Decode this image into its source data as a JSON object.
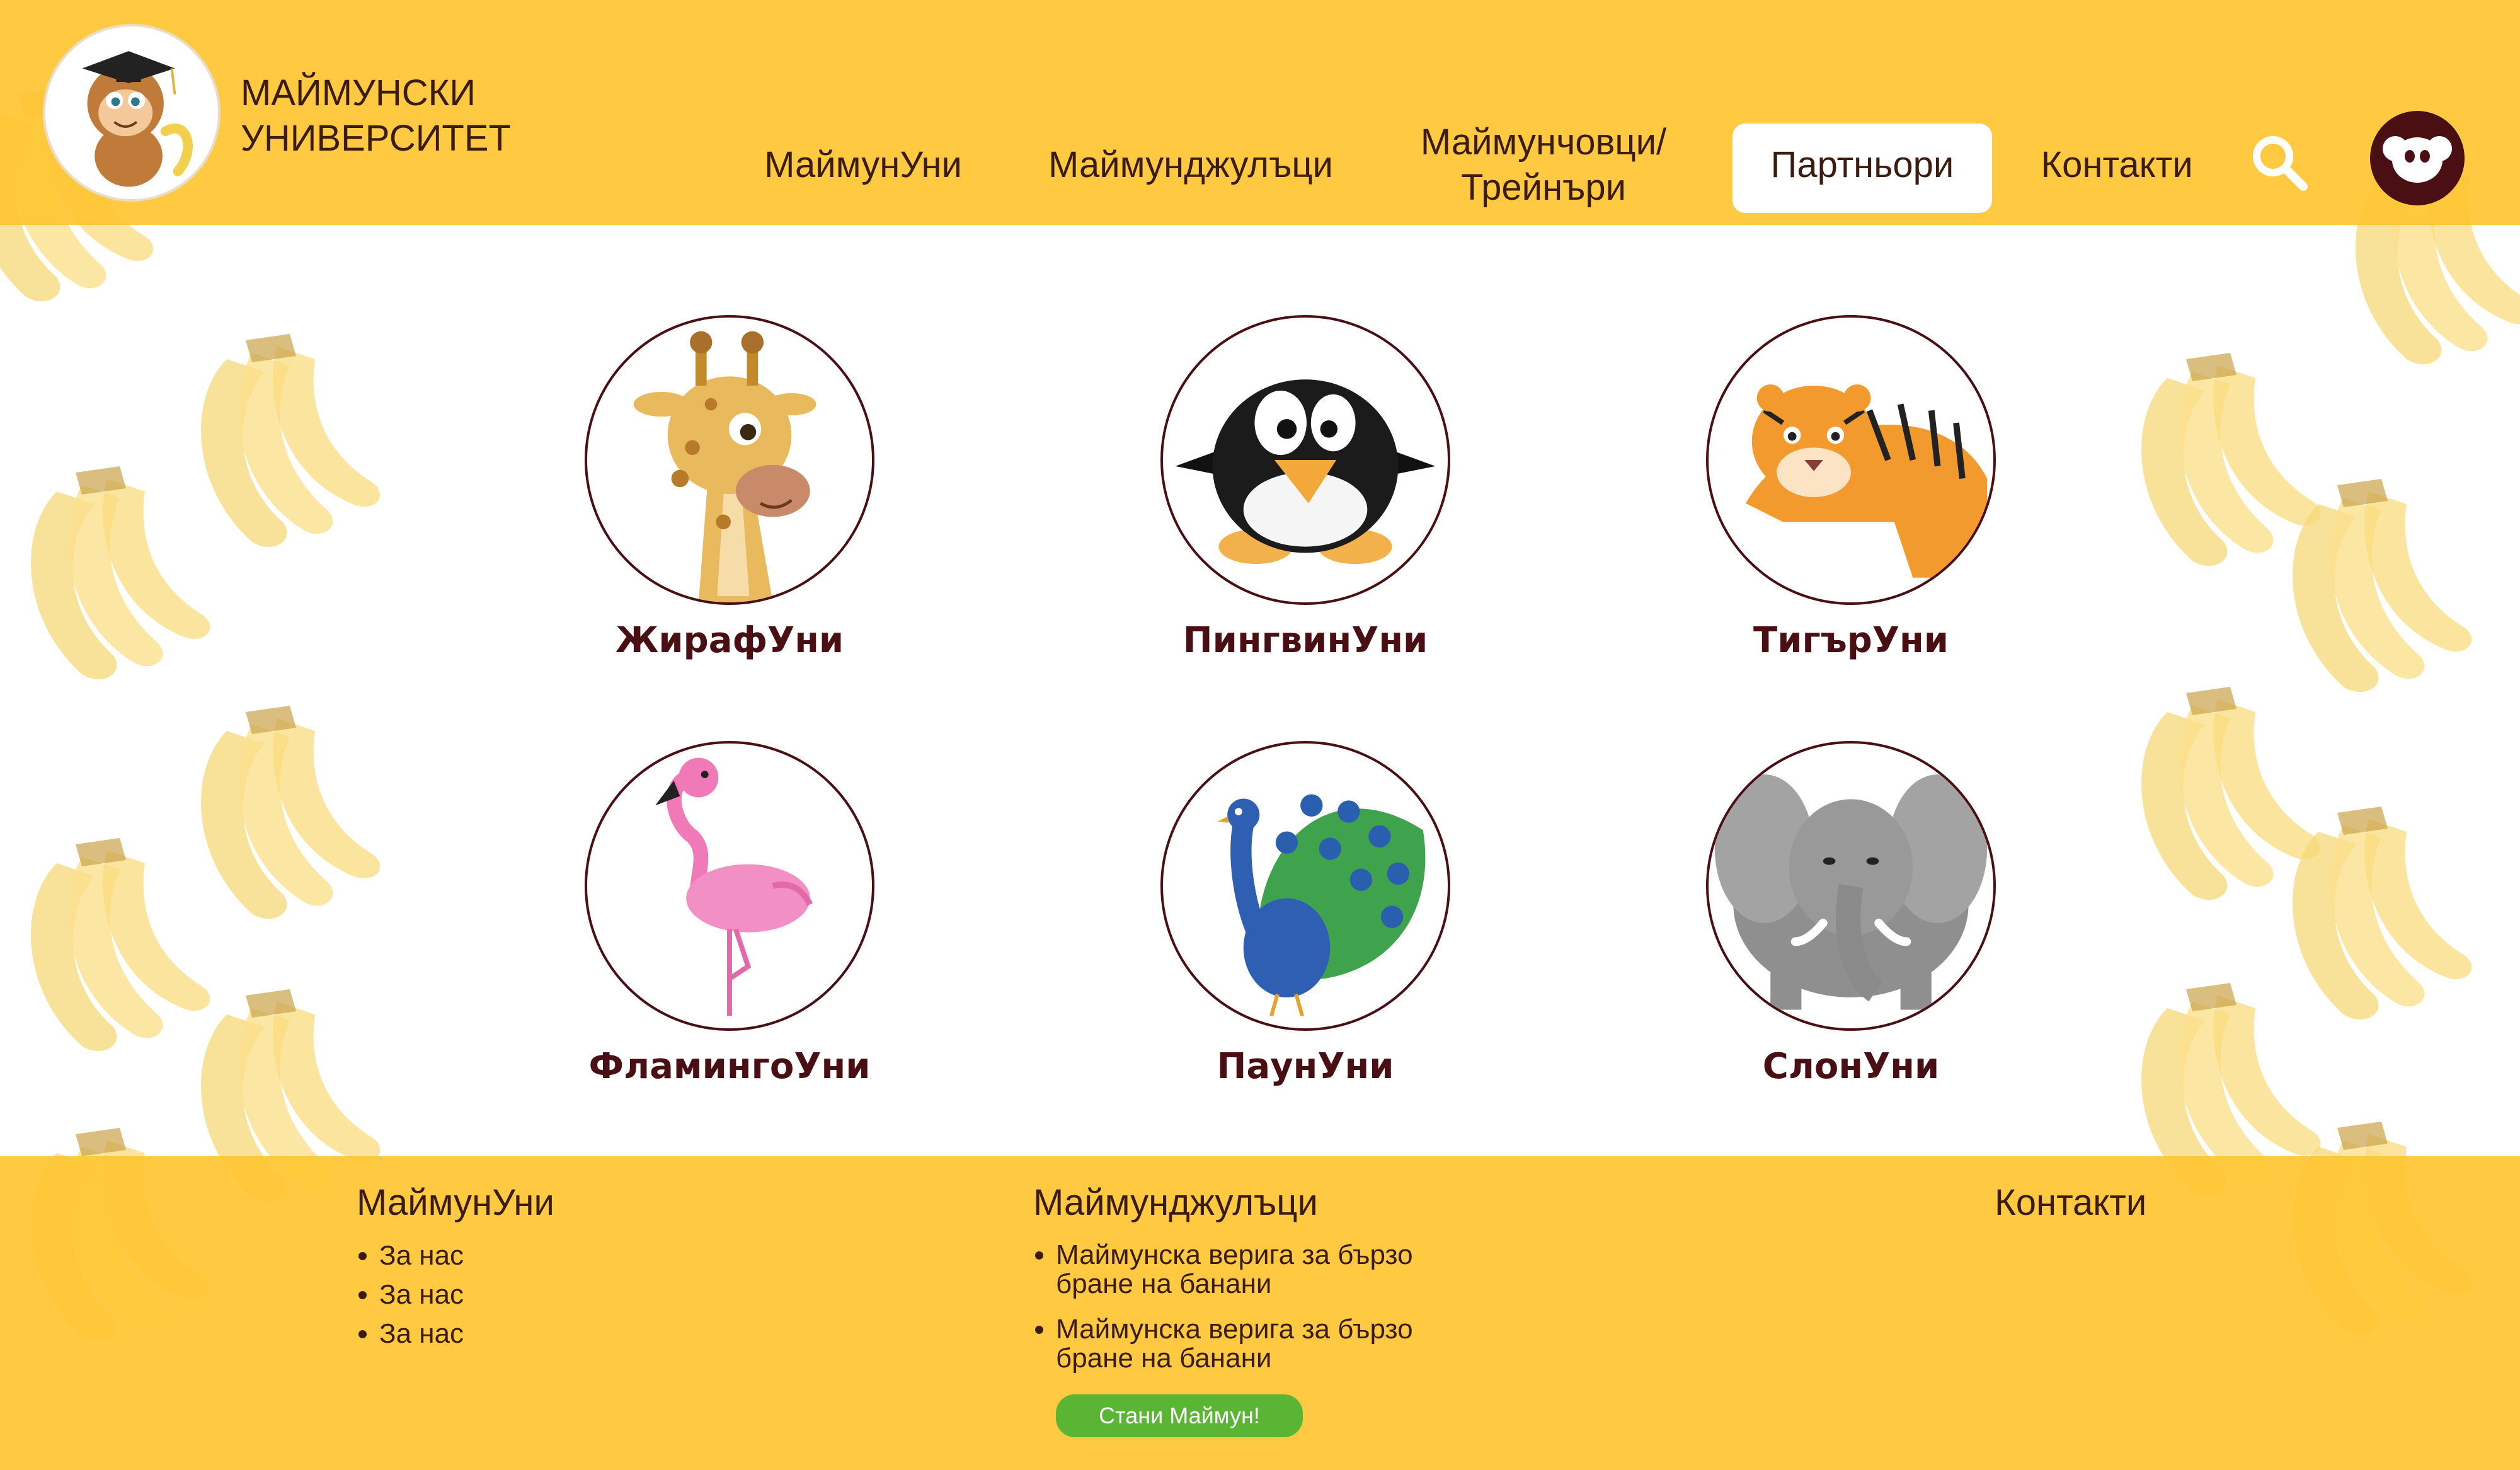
{
  "brand": {
    "name": "МАЙМУНСКИ УНИВЕРСИТЕТ"
  },
  "nav": {
    "items": [
      "МаймунУни",
      "Маймунджулъци",
      "Маймунчовци/ Трейнъри",
      "Партньори",
      "Контакти"
    ],
    "active": "Партньори"
  },
  "icons": {
    "search": "search-icon",
    "account": "monkey-avatar-icon",
    "logo": "monkey-graduate-logo"
  },
  "partners": [
    {
      "label": "ЖирафУни",
      "icon": "giraffe"
    },
    {
      "label": "ПингвинУни",
      "icon": "penguin"
    },
    {
      "label": "ТигърУни",
      "icon": "tiger"
    },
    {
      "label": "ФламингоУни",
      "icon": "flamingo"
    },
    {
      "label": "ПаунУни",
      "icon": "peacock"
    },
    {
      "label": "СлонУни",
      "icon": "elephant"
    }
  ],
  "footer": {
    "col1": {
      "title": "МаймунУни",
      "links": [
        "За нас",
        "За нас",
        "За нас"
      ]
    },
    "col2": {
      "title": "Маймунджулъци",
      "links": [
        "Маймунска верига за бързо бране на банани",
        "Маймунска верига за бързо бране на банани"
      ],
      "cta": "Стани Маймун!"
    },
    "col3": {
      "title": "Контакти"
    }
  },
  "colors": {
    "primary_yellow": "#FFC634",
    "dark_brown": "#4A0F12",
    "cta_green": "#5AB534",
    "banana": "#FCE38A"
  }
}
